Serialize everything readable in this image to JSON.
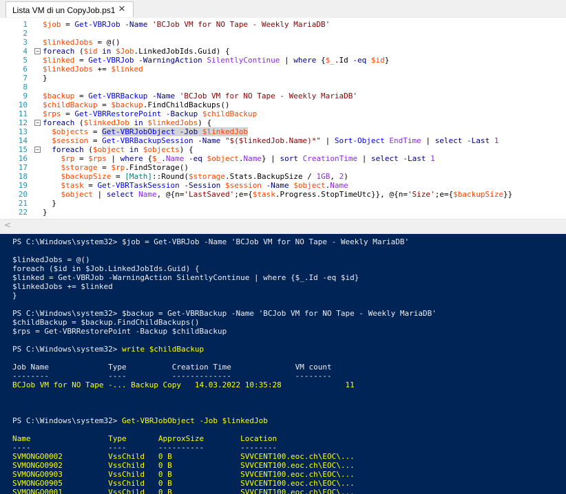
{
  "tab": {
    "title": "Lista VM di un CopyJob.ps1",
    "close_glyph": "×"
  },
  "colors": {
    "editor_bg": "#ffffff",
    "line_number": "#2b91af",
    "variable": "#ff4500",
    "cmdlet": "#0000ff",
    "parameter": "#000080",
    "string": "#8b0000",
    "keyword": "#00008b",
    "property_arg": "#8a2be2",
    "console_bg": "#012456",
    "console_text": "#eeedf0",
    "console_highlight": "#ffff00"
  },
  "editor": {
    "lines": [
      {
        "n": "1",
        "fold": "",
        "code": "$job = Get-VBRJob -Name 'BCJob VM for NO Tape - Weekly MariaDB'"
      },
      {
        "n": "2",
        "fold": "",
        "code": ""
      },
      {
        "n": "3",
        "fold": "",
        "code": "$linkedJobs = @()"
      },
      {
        "n": "4",
        "fold": "-",
        "code": "foreach ($id in $Job.LinkedJobIds.Guid) {"
      },
      {
        "n": "5",
        "fold": "",
        "code": "$linked = Get-VBRJob -WarningAction SilentlyContinue | where {$_.Id -eq $id}"
      },
      {
        "n": "6",
        "fold": "",
        "code": "$linkedJobs += $linked"
      },
      {
        "n": "7",
        "fold": "",
        "code": "}"
      },
      {
        "n": "8",
        "fold": "",
        "code": ""
      },
      {
        "n": "9",
        "fold": "",
        "code": "$backup = Get-VBRBackup -Name 'BCJob VM for NO Tape - Weekly MariaDB'"
      },
      {
        "n": "10",
        "fold": "",
        "code": "$childBackup = $backup.FindChildBackups()"
      },
      {
        "n": "11",
        "fold": "",
        "code": "$rps = Get-VBRRestorePoint -Backup $childBackup"
      },
      {
        "n": "12",
        "fold": "-",
        "code": "foreach ($linkedJob in $linkedJobs) {"
      },
      {
        "n": "13",
        "fold": "",
        "code": "  $objects = Get-VBRJobObject -Job $linkedJob",
        "selected": true
      },
      {
        "n": "14",
        "fold": "",
        "code": "  $session = Get-VBRBackupSession -Name \"$($linkedJob.Name)*\" | Sort-Object EndTime | select -Last 1"
      },
      {
        "n": "15",
        "fold": "-",
        "code": "  foreach ($object in $objects) {"
      },
      {
        "n": "16",
        "fold": "",
        "code": "    $rp = $rps | where {$_.Name -eq $object.Name} | sort CreationTime | select -Last 1"
      },
      {
        "n": "17",
        "fold": "",
        "code": "    $storage = $rp.FindStorage()"
      },
      {
        "n": "18",
        "fold": "",
        "code": "    $backupSize = [Math]::Round($storage.Stats.BackupSize / 1GB, 2)"
      },
      {
        "n": "19",
        "fold": "",
        "code": "    $task = Get-VBRTaskSession -Session $session -Name $object.Name"
      },
      {
        "n": "20",
        "fold": "",
        "code": "    $object | select Name, @{n='LastSaved';e={$task.Progress.StopTimeUtc}}, @{n='Size';e={$backupSize}}"
      },
      {
        "n": "21",
        "fold": "",
        "code": "  }"
      },
      {
        "n": "22",
        "fold": "",
        "code": "}"
      }
    ],
    "scroll_left_glyph": "<"
  },
  "console": {
    "lines": [
      {
        "style": "prompt",
        "prompt": "PS C:\\Windows\\system32> ",
        "cmd": "",
        "rest": "$job = Get-VBRJob -Name 'BCJob VM for NO Tape - Weekly MariaDB'"
      },
      {
        "style": "normal",
        "text": ""
      },
      {
        "style": "normal",
        "text": "$linkedJobs = @()"
      },
      {
        "style": "normal",
        "text": "foreach ($id in $Job.LinkedJobIds.Guid) {"
      },
      {
        "style": "normal",
        "text": "$linked = Get-VBRJob -WarningAction SilentlyContinue | where {$_.Id -eq $id}"
      },
      {
        "style": "normal",
        "text": "$linkedJobs += $linked"
      },
      {
        "style": "normal",
        "text": "}"
      },
      {
        "style": "normal",
        "text": ""
      },
      {
        "style": "prompt",
        "prompt": "PS C:\\Windows\\system32> ",
        "cmd": "",
        "rest": "$backup = Get-VBRBackup -Name 'BCJob VM for NO Tape - Weekly MariaDB'"
      },
      {
        "style": "normal",
        "text": "$childBackup = $backup.FindChildBackups()"
      },
      {
        "style": "normal",
        "text": "$rps = Get-VBRRestorePoint -Backup $childBackup"
      },
      {
        "style": "normal",
        "text": ""
      },
      {
        "style": "prompt",
        "prompt": "PS C:\\Windows\\system32> ",
        "cmd": "write $childBackup",
        "rest": ""
      },
      {
        "style": "normal",
        "text": ""
      },
      {
        "style": "normal",
        "text": "Job Name             Type          Creation Time              VM count"
      },
      {
        "style": "normal",
        "text": "--------             ----          -------------              --------"
      },
      {
        "style": "yellow",
        "text": "BCJob VM for NO Tape -... Backup Copy   14.03.2022 10:35:28              11"
      },
      {
        "style": "normal",
        "text": ""
      },
      {
        "style": "normal",
        "text": ""
      },
      {
        "style": "normal",
        "text": ""
      },
      {
        "style": "prompt",
        "prompt": "PS C:\\Windows\\system32> ",
        "cmd": "Get-VBRJobObject -Job $linkedJob",
        "rest": ""
      },
      {
        "style": "normal",
        "text": ""
      },
      {
        "style": "yellow",
        "text": "Name                 Type       ApproxSize        Location"
      },
      {
        "style": "normal",
        "text": "----                 ----       ----------        --------"
      },
      {
        "style": "yellow",
        "text": "SVMONGO0002          VssChild   0 B               SVVCENT100.eoc.ch\\EOC\\..."
      },
      {
        "style": "yellow",
        "text": "SVMONGO0902          VssChild   0 B               SVVCENT100.eoc.ch\\EOC\\..."
      },
      {
        "style": "yellow",
        "text": "SVMONGO0903          VssChild   0 B               SVVCENT100.eoc.ch\\EOC\\..."
      },
      {
        "style": "yellow",
        "text": "SVMONGO0905          VssChild   0 B               SVVCENT100.eoc.ch\\EOC\\..."
      },
      {
        "style": "yellow",
        "text": "SVMONGO0001          VssChild   0 B               SVVCENT100.eoc.ch\\EOC\\..."
      }
    ]
  }
}
